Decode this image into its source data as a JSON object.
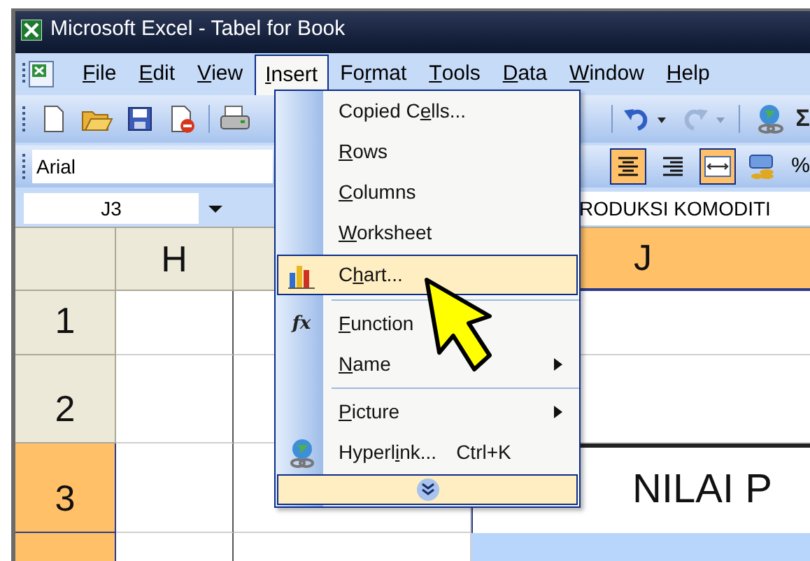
{
  "window": {
    "title": "Microsoft Excel - Tabel for Book"
  },
  "menu_bar": [
    {
      "key": "F",
      "rest": "ile",
      "selected": false
    },
    {
      "key": "E",
      "rest": "dit",
      "selected": false
    },
    {
      "key": "V",
      "rest": "iew",
      "selected": false
    },
    {
      "key": "I",
      "rest": "nsert",
      "selected": true
    },
    {
      "pre": "Fo",
      "key": "r",
      "rest": "mat",
      "selected": false
    },
    {
      "key": "T",
      "rest": "ools",
      "selected": false
    },
    {
      "key": "D",
      "rest": "ata",
      "selected": false
    },
    {
      "key": "W",
      "rest": "indow",
      "selected": false
    },
    {
      "key": "H",
      "rest": "elp",
      "selected": false
    }
  ],
  "standard_toolbar": {
    "sum_symbol": "Σ"
  },
  "formatting_toolbar": {
    "font": "Arial",
    "buttons": [
      {
        "kind": "align-center",
        "selected": true
      },
      {
        "kind": "align-right",
        "selected": false
      },
      {
        "kind": "merge",
        "selected": true
      },
      {
        "kind": "currency",
        "selected": false
      }
    ],
    "percent": "%"
  },
  "formula_bar": {
    "name_box": "J3",
    "content": "RODUKSI KOMODITI"
  },
  "sheet": {
    "columns": [
      {
        "label": "H",
        "selected": false
      },
      {
        "selected": false
      },
      {
        "label": "J",
        "selected": true
      }
    ],
    "rows": [
      {
        "label": "1",
        "selected": false
      },
      {
        "label": "2",
        "selected": false
      },
      {
        "label": "3",
        "selected": true,
        "cell_j": "NILAI P"
      },
      {
        "selected": true
      }
    ]
  },
  "insert_menu": [
    {
      "kind": "item",
      "pre": "Copied C",
      "key": "e",
      "rest": "lls...",
      "selected": false
    },
    {
      "kind": "item",
      "key": "R",
      "rest": "ows",
      "selected": false
    },
    {
      "kind": "item",
      "key": "C",
      "rest": "olumns",
      "selected": false
    },
    {
      "kind": "item",
      "key": "W",
      "rest": "orksheet",
      "selected": false
    },
    {
      "kind": "item",
      "pre": "C",
      "key": "h",
      "rest": "art...",
      "selected": true
    },
    {
      "kind": "separator"
    },
    {
      "kind": "item",
      "icon_text": "fx",
      "key": "F",
      "rest": "unction",
      "selected": false
    },
    {
      "kind": "item",
      "key": "N",
      "rest": "ame",
      "selected": false,
      "submenu": true
    },
    {
      "kind": "separator"
    },
    {
      "kind": "item",
      "key": "P",
      "rest": "icture",
      "selected": false,
      "submenu": true
    },
    {
      "kind": "item",
      "pre": "Hyperl",
      "key": "i",
      "rest": "nk...",
      "shortcut": "Ctrl+K",
      "selected": false
    },
    {
      "kind": "expand",
      "selected": true
    }
  ]
}
